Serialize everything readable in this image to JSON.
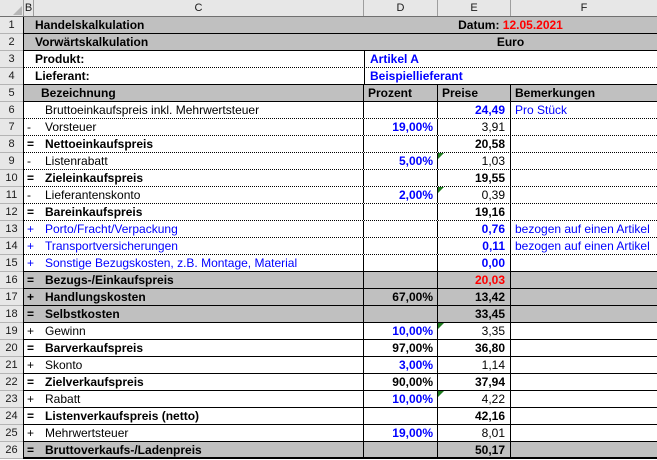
{
  "sheet": {
    "column_headers": [
      "B",
      "C",
      "D",
      "E",
      "F"
    ],
    "colors": {
      "accent_blue": "#0000FF",
      "alert_red": "#FF0000",
      "band_silver": "#C0C0C0",
      "header_gray": "#E7E7E7",
      "grid_black": "#000000",
      "flag_green": "#1E7B1E"
    },
    "rows": [
      {
        "num": "1",
        "kind": "band-title",
        "band": true,
        "sep": "solid",
        "left": "Handelskalkulation",
        "right_label": "Datum: ",
        "right_value": "12.05.2021"
      },
      {
        "num": "2",
        "kind": "band-title",
        "band": true,
        "sep": "solid",
        "left": "Vorwärtskalkulation",
        "right_center": "Euro"
      },
      {
        "num": "3",
        "kind": "info",
        "sep": "dotted",
        "label": "Produkt:",
        "value": "Artikel A"
      },
      {
        "num": "4",
        "kind": "info",
        "sep": "solid",
        "label": "Lieferant:",
        "value": "Beispiellieferant"
      },
      {
        "num": "5",
        "kind": "head",
        "band": true,
        "sep": "solid",
        "c": "Bezeichnung",
        "d": "Prozent",
        "e": "Preise",
        "f": "Bemerkungen"
      },
      {
        "num": "6",
        "kind": "data",
        "sep": "dotted",
        "op": "",
        "label": "Bruttoeinkaufspreis inkl. Mehrwertsteuer",
        "label_style": "plain",
        "pct": "",
        "pct_style": "",
        "price": "24,49",
        "price_style": "input",
        "note": "Pro Stück",
        "flag": false,
        "band": false
      },
      {
        "num": "7",
        "kind": "data",
        "sep": "dotted",
        "op": "-",
        "label": "Vorsteuer",
        "label_style": "plain",
        "pct": "19,00%",
        "pct_style": "input",
        "price": "3,91",
        "price_style": "plain",
        "note": "",
        "flag": false,
        "band": false
      },
      {
        "num": "8",
        "kind": "data",
        "sep": "dotted",
        "op": "=",
        "label": "Nettoeinkaufspreis",
        "label_style": "bold",
        "pct": "",
        "pct_style": "",
        "price": "20,58",
        "price_style": "bold",
        "note": "",
        "flag": false,
        "band": false
      },
      {
        "num": "9",
        "kind": "data",
        "sep": "dotted",
        "op": "-",
        "label": "Listenrabatt",
        "label_style": "plain",
        "pct": "5,00%",
        "pct_style": "input",
        "price": "1,03",
        "price_style": "plain",
        "note": "",
        "flag": true,
        "band": false
      },
      {
        "num": "10",
        "kind": "data",
        "sep": "dotted",
        "op": "=",
        "label": "Zieleinkaufspreis",
        "label_style": "bold",
        "pct": "",
        "pct_style": "",
        "price": "19,55",
        "price_style": "bold",
        "note": "",
        "flag": false,
        "band": false
      },
      {
        "num": "11",
        "kind": "data",
        "sep": "dotted",
        "op": "-",
        "label": "Lieferantenskonto",
        "label_style": "plain",
        "pct": "2,00%",
        "pct_style": "input",
        "price": "0,39",
        "price_style": "plain",
        "note": "",
        "flag": true,
        "band": false
      },
      {
        "num": "12",
        "kind": "data",
        "sep": "dotted",
        "op": "=",
        "label": "Bareinkaufspreis",
        "label_style": "bold",
        "pct": "",
        "pct_style": "",
        "price": "19,16",
        "price_style": "bold",
        "note": "",
        "flag": false,
        "band": false
      },
      {
        "num": "13",
        "kind": "data",
        "sep": "dotted",
        "op": "+",
        "label": "Porto/Fracht/Verpackung",
        "label_style": "blue",
        "pct": "",
        "pct_style": "",
        "price": "0,76",
        "price_style": "input",
        "note": "bezogen auf einen Artikel",
        "flag": false,
        "band": false
      },
      {
        "num": "14",
        "kind": "data",
        "sep": "dotted",
        "op": "+",
        "label": "Transportversicherungen",
        "label_style": "blue",
        "pct": "",
        "pct_style": "",
        "price": "0,11",
        "price_style": "input",
        "note": "bezogen auf einen Artikel",
        "flag": false,
        "band": false
      },
      {
        "num": "15",
        "kind": "data",
        "sep": "solid",
        "op": "+",
        "label": "Sonstige Bezugskosten, z.B. Montage, Material",
        "label_style": "blue",
        "pct": "",
        "pct_style": "",
        "price": "0,00",
        "price_style": "input",
        "note": "",
        "flag": false,
        "band": false
      },
      {
        "num": "16",
        "kind": "data",
        "sep": "solid",
        "op": "=",
        "label": "Bezugs-/Einkaufspreis",
        "label_style": "bold",
        "pct": "",
        "pct_style": "",
        "price": "20,03",
        "price_style": "alert",
        "note": "",
        "flag": false,
        "band": true
      },
      {
        "num": "17",
        "kind": "data",
        "sep": "solid",
        "op": "+",
        "label": "Handlungskosten",
        "label_style": "bold",
        "pct": "67,00%",
        "pct_style": "calc",
        "price": "13,42",
        "price_style": "bold",
        "note": "",
        "flag": false,
        "band": true
      },
      {
        "num": "18",
        "kind": "data",
        "sep": "solid",
        "op": "=",
        "label": "Selbstkosten",
        "label_style": "bold",
        "pct": "",
        "pct_style": "",
        "price": "33,45",
        "price_style": "bold",
        "note": "",
        "flag": false,
        "band": true
      },
      {
        "num": "19",
        "kind": "data",
        "sep": "solid",
        "op": "+",
        "label": "Gewinn",
        "label_style": "plain",
        "pct": "10,00%",
        "pct_style": "input",
        "price": "3,35",
        "price_style": "plain",
        "note": "",
        "flag": true,
        "band": false
      },
      {
        "num": "20",
        "kind": "data",
        "sep": "solid",
        "op": "=",
        "label": "Barverkaufspreis",
        "label_style": "bold",
        "pct": "97,00%",
        "pct_style": "calc",
        "price": "36,80",
        "price_style": "bold",
        "note": "",
        "flag": false,
        "band": false
      },
      {
        "num": "21",
        "kind": "data",
        "sep": "solid",
        "op": "+",
        "label": "Skonto",
        "label_style": "plain",
        "pct": "3,00%",
        "pct_style": "input",
        "price": "1,14",
        "price_style": "plain",
        "note": "",
        "flag": false,
        "band": false
      },
      {
        "num": "22",
        "kind": "data",
        "sep": "solid",
        "op": "=",
        "label": "Zielverkaufspreis",
        "label_style": "bold",
        "pct": "90,00%",
        "pct_style": "calc",
        "price": "37,94",
        "price_style": "bold",
        "note": "",
        "flag": false,
        "band": false
      },
      {
        "num": "23",
        "kind": "data",
        "sep": "solid",
        "op": "+",
        "label": "Rabatt",
        "label_style": "plain",
        "pct": "10,00%",
        "pct_style": "input",
        "price": "4,22",
        "price_style": "plain",
        "note": "",
        "flag": true,
        "band": false
      },
      {
        "num": "24",
        "kind": "data",
        "sep": "solid",
        "op": "=",
        "label": "Listenverkaufspreis (netto)",
        "label_style": "bold",
        "pct": "",
        "pct_style": "",
        "price": "42,16",
        "price_style": "bold",
        "note": "",
        "flag": false,
        "band": false
      },
      {
        "num": "25",
        "kind": "data",
        "sep": "solid",
        "op": "+",
        "label": "Mehrwertsteuer",
        "label_style": "plain",
        "pct": "19,00%",
        "pct_style": "input",
        "price": "8,01",
        "price_style": "plain",
        "note": "",
        "flag": false,
        "band": false
      },
      {
        "num": "26",
        "kind": "data",
        "sep": "thick",
        "op": "=",
        "label": "Bruttoverkaufs-/Ladenpreis",
        "label_style": "bold",
        "pct": "",
        "pct_style": "",
        "price": "50,17",
        "price_style": "bold",
        "note": "",
        "flag": false,
        "band": true
      }
    ]
  }
}
